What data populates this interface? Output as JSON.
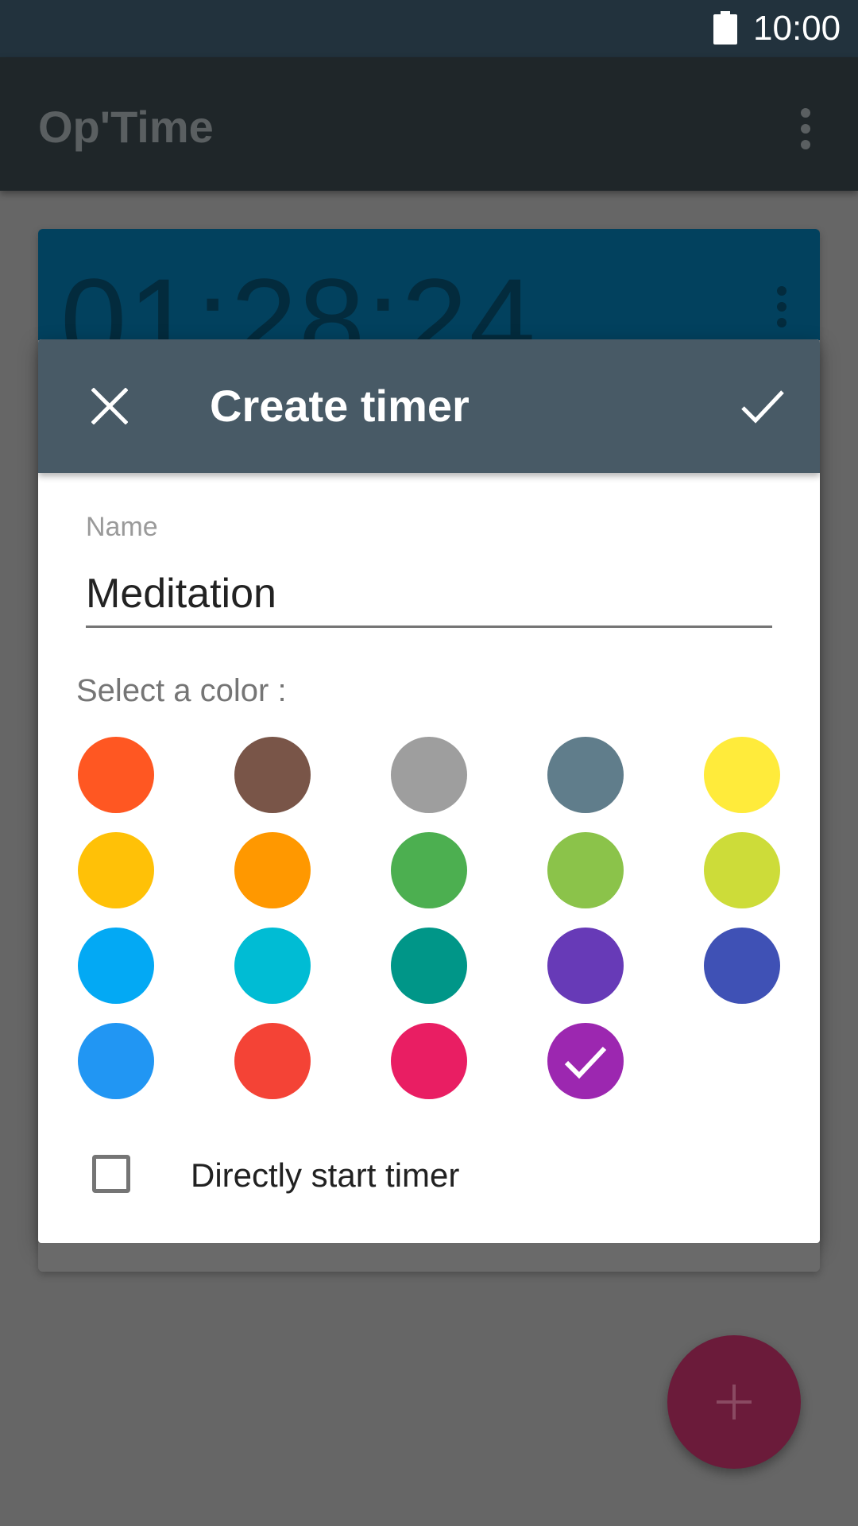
{
  "status_bar": {
    "time": "10:00",
    "battery_icon": "battery-full-icon"
  },
  "app_bar": {
    "title": "Op'Time",
    "menu_icon": "more-vert-icon"
  },
  "timer_card": {
    "value": "01:28:24",
    "color": "#02415e",
    "menu_icon": "more-vert-icon"
  },
  "fab": {
    "icon": "add-icon",
    "color": "#6b1b3a"
  },
  "dialog": {
    "title": "Create timer",
    "close_icon": "close-icon",
    "confirm_icon": "check-icon",
    "toolbar_color": "#485a66",
    "name_field": {
      "label": "Name",
      "value": "Meditation"
    },
    "color_label": "Select a color :",
    "colors": [
      "#ff5722",
      "#795548",
      "#9e9e9e",
      "#607d8b",
      "#ffeb3b",
      "#ffc107",
      "#ff9800",
      "#4caf50",
      "#8bc34a",
      "#cddc39",
      "#03a9f4",
      "#00bcd4",
      "#009688",
      "#673ab7",
      "#3f51b5",
      "#2196f3",
      "#f44336",
      "#e91e63",
      "#9c27b0"
    ],
    "selected_color_index": 18,
    "direct_start": {
      "label": "Directly start timer",
      "checked": false
    }
  }
}
